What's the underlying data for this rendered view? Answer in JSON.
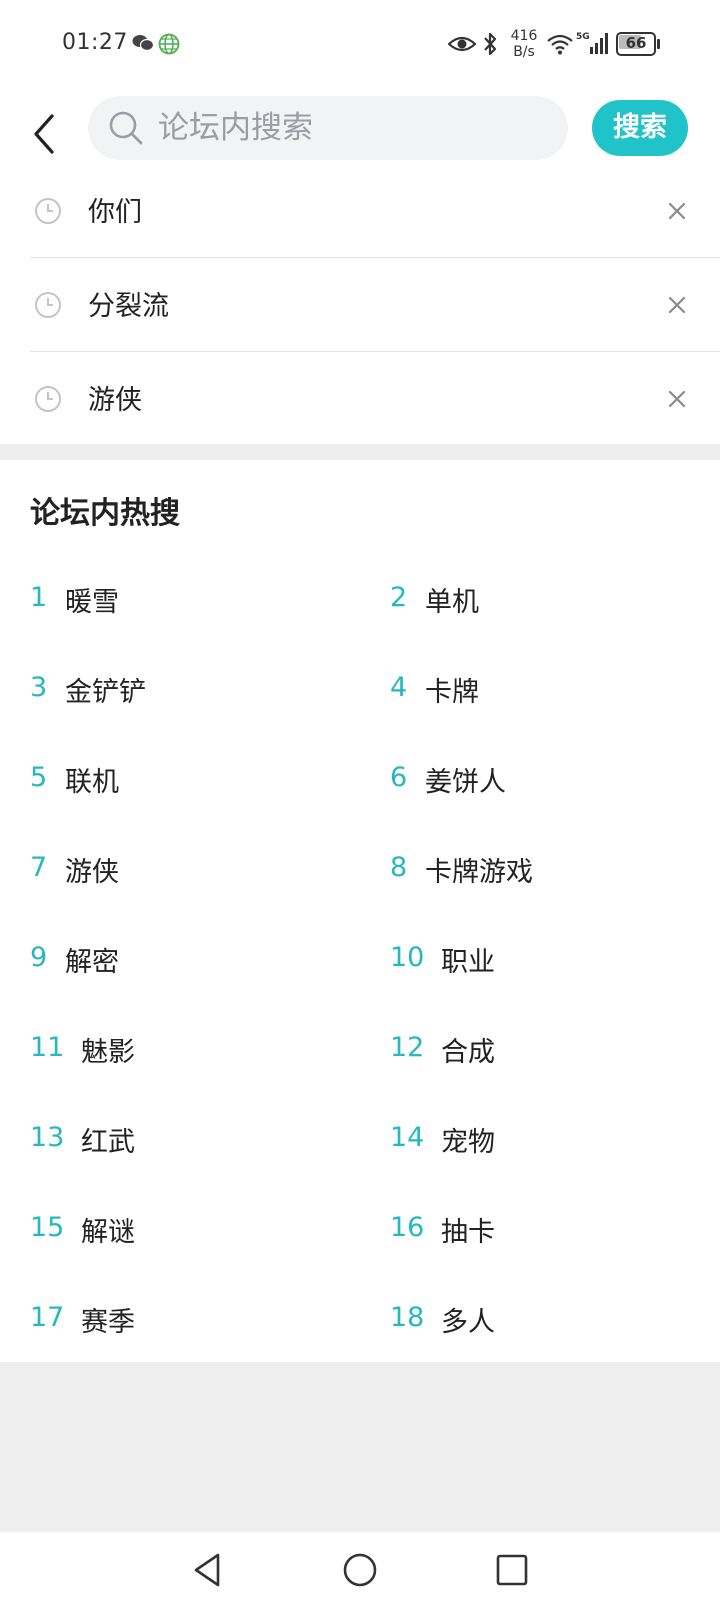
{
  "status_bar": {
    "time": "01:27",
    "net_speed_value": "416",
    "net_speed_unit": "B/s",
    "battery": "66",
    "icons": [
      "wechat-icon",
      "globe-icon",
      "eye-icon",
      "bluetooth-icon",
      "wifi-icon",
      "signal-5g-icon",
      "battery-icon"
    ]
  },
  "header": {
    "search_placeholder": "论坛内搜索",
    "search_value": "",
    "search_button": "搜索"
  },
  "history": [
    {
      "text": "你们"
    },
    {
      "text": "分裂流"
    },
    {
      "text": "游侠"
    }
  ],
  "hot": {
    "title": "论坛内热搜",
    "items": [
      {
        "rank": "1",
        "label": "暖雪"
      },
      {
        "rank": "2",
        "label": "单机"
      },
      {
        "rank": "3",
        "label": "金铲铲"
      },
      {
        "rank": "4",
        "label": "卡牌"
      },
      {
        "rank": "5",
        "label": "联机"
      },
      {
        "rank": "6",
        "label": "姜饼人"
      },
      {
        "rank": "7",
        "label": "游侠"
      },
      {
        "rank": "8",
        "label": "卡牌游戏"
      },
      {
        "rank": "9",
        "label": "解密"
      },
      {
        "rank": "10",
        "label": "职业"
      },
      {
        "rank": "11",
        "label": "魅影"
      },
      {
        "rank": "12",
        "label": "合成"
      },
      {
        "rank": "13",
        "label": "红武"
      },
      {
        "rank": "14",
        "label": "宠物"
      },
      {
        "rank": "15",
        "label": "解谜"
      },
      {
        "rank": "16",
        "label": "抽卡"
      },
      {
        "rank": "17",
        "label": "赛季"
      },
      {
        "rank": "18",
        "label": "多人"
      }
    ]
  },
  "colors": {
    "accent": "#1fc3c8",
    "rank": "#26b8bd",
    "band": "#eeeeee"
  }
}
